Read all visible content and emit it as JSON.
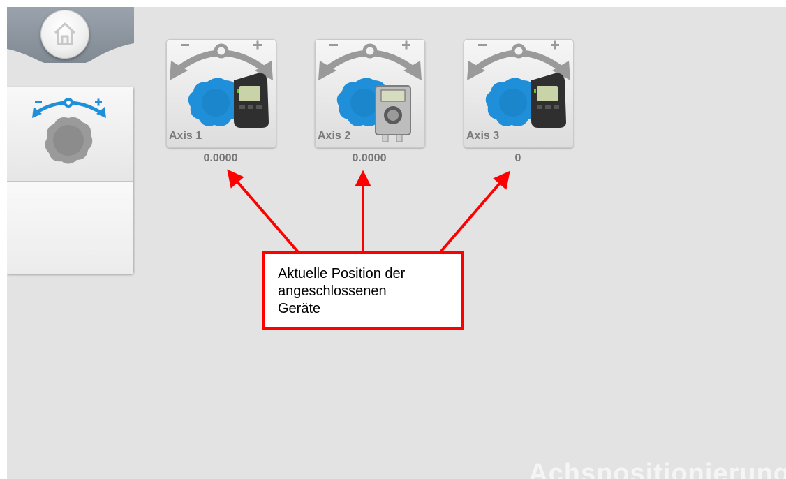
{
  "sidebar": {
    "home_icon": "home-icon",
    "menu_items": [
      {
        "icon": "axis-positioning-icon"
      },
      {
        "icon": ""
      }
    ]
  },
  "axes": [
    {
      "label": "Axis 1",
      "value": "0.0000",
      "device": "positioning-device-display"
    },
    {
      "label": "Axis 2",
      "value": "0.0000",
      "device": "positioning-device-square"
    },
    {
      "label": "Axis 3",
      "value": "0",
      "device": "positioning-device-display"
    }
  ],
  "annotation": {
    "text_line1": "Aktuelle Position der",
    "text_line2": "angeschlossenen",
    "text_line3": "Geräte",
    "color": "#ff0000"
  },
  "page_title": "Achspositionierung",
  "colors": {
    "accent": "#1e8fd8",
    "background": "#e3e3e3"
  }
}
